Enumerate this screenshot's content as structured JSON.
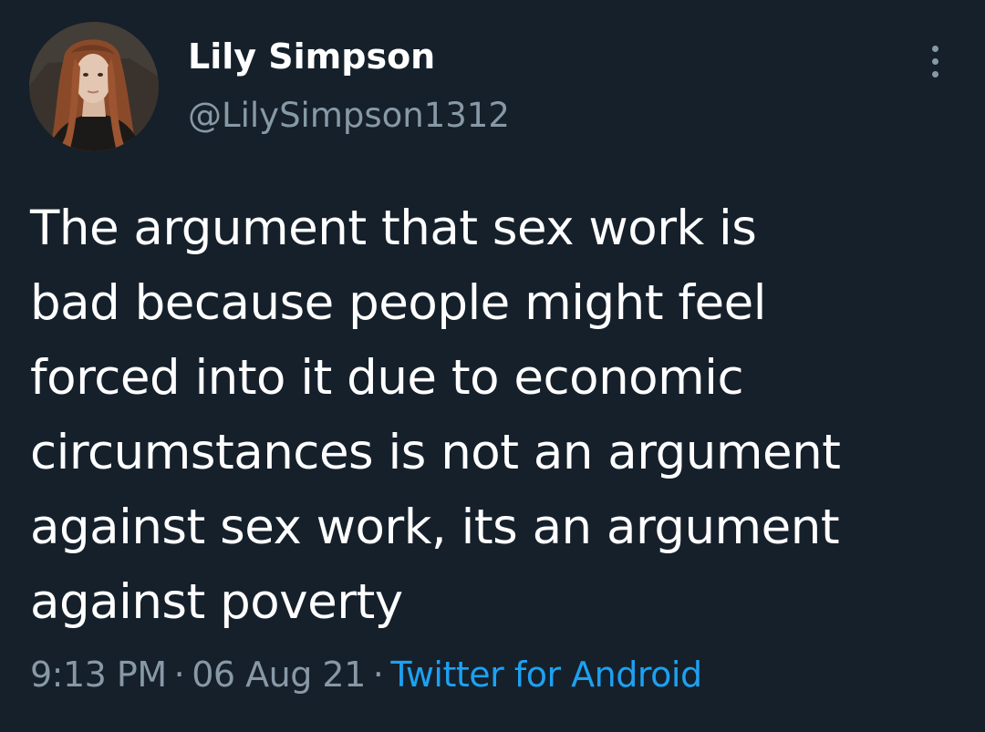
{
  "tweet": {
    "author": {
      "display_name": "Lily Simpson",
      "handle": "@LilySimpson1312",
      "avatar_icon": "profile-photo"
    },
    "text": "The argument that sex work is\nbad because people might feel\nforced into it due to economic\ncircumstances is not an argument\nagainst sex work, its an argument\nagainst poverty",
    "time": "9:13 PM",
    "separator": "·",
    "date": "06 Aug 21",
    "source": "Twitter for Android",
    "more_icon": "vertical-ellipsis-icon"
  },
  "colors": {
    "background": "#15202b",
    "primary_text": "#ffffff",
    "secondary_text": "#8899a6",
    "link": "#1da1f2"
  }
}
